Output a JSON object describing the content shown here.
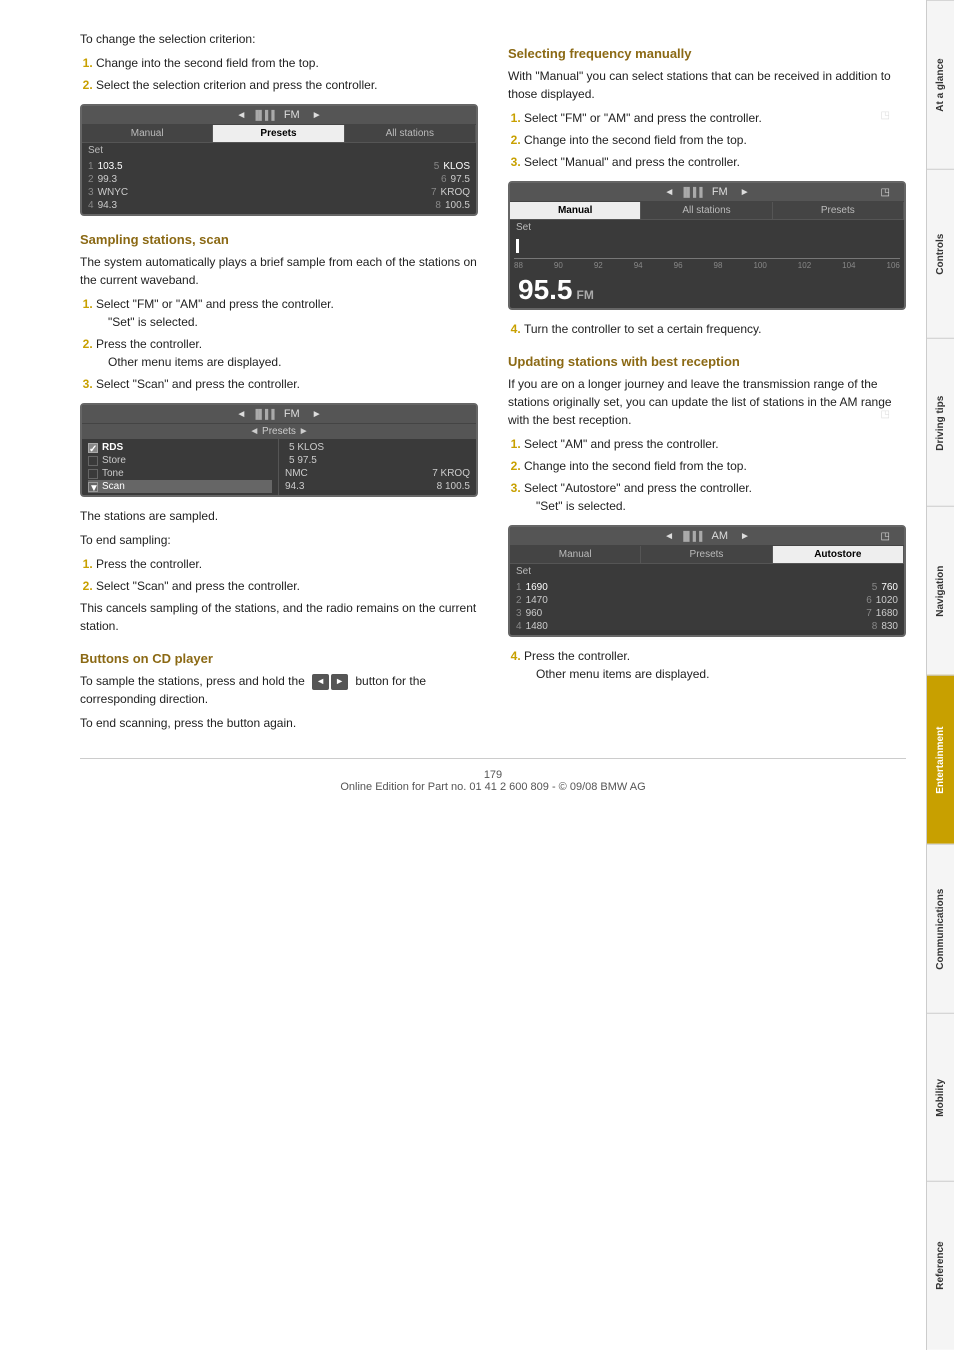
{
  "page": {
    "page_number": "179",
    "footer": "Online Edition for Part no. 01 41 2 600 809 - © 09/08 BMW AG"
  },
  "tabs": [
    {
      "id": "at-a-glance",
      "label": "At a glance",
      "active": false
    },
    {
      "id": "controls",
      "label": "Controls",
      "active": false
    },
    {
      "id": "driving-tips",
      "label": "Driving tips",
      "active": false
    },
    {
      "id": "navigation",
      "label": "Navigation",
      "active": false
    },
    {
      "id": "entertainment",
      "label": "Entertainment",
      "active": true
    },
    {
      "id": "communications",
      "label": "Communications",
      "active": false
    },
    {
      "id": "mobility",
      "label": "Mobility",
      "active": false
    },
    {
      "id": "reference",
      "label": "Reference",
      "active": false
    }
  ],
  "left": {
    "intro": "To change the selection criterion:",
    "steps_initial": [
      "Change into the second field from the top.",
      "Select the selection criterion and press the controller."
    ],
    "screen1": {
      "header": "FM",
      "tabs": [
        "Manual",
        "Presets",
        "All stations"
      ],
      "selected_tab": "Presets",
      "set_label": "Set",
      "stations": [
        {
          "num": "1",
          "name": "103.5",
          "num2": "5",
          "name2": "KLOS"
        },
        {
          "num": "2",
          "name": "99.3",
          "num2": "6",
          "name2": "97.5"
        },
        {
          "num": "",
          "name": "3 WNYC",
          "num2": "7",
          "name2": "KROQ"
        },
        {
          "num": "",
          "name": "4 94.3",
          "num2": "8",
          "name2": "100.5"
        }
      ]
    },
    "sampling_title": "Sampling stations, scan",
    "sampling_intro": "The system automatically plays a brief sample from each of the stations on the current waveband.",
    "sampling_steps": [
      {
        "text": "Select \"FM\" or \"AM\" and press the controller.",
        "sub": "\"Set\" is selected."
      },
      {
        "text": "Press the controller.",
        "sub": "Other menu items are displayed."
      },
      {
        "text": "Select \"Scan\" and press the controller."
      }
    ],
    "screen2": {
      "header": "FM",
      "presets_label": "◄ Presets ►",
      "menu_items": [
        {
          "label": "RDS",
          "checked": true
        },
        {
          "label": "Store",
          "checked": false
        },
        {
          "label": "Tone",
          "checked": false
        },
        {
          "label": "Scan",
          "checked": false,
          "active": true
        }
      ],
      "stations": [
        {
          "num": "5",
          "name": "KLOS"
        },
        {
          "num": "",
          "name": "5 97.5"
        },
        {
          "num": "NMC",
          "name": "7 KROQ"
        },
        {
          "num": "94.3",
          "name": "8 100.5"
        }
      ]
    },
    "sampled_note": "The stations are sampled.",
    "end_sampling": "To end sampling:",
    "end_steps": [
      "Press the controller.",
      "Select \"Scan\" and press the controller."
    ],
    "cancel_note": "This cancels sampling of the stations, and the radio remains on the current station.",
    "cd_title": "Buttons on CD player",
    "cd_text1": "To sample the stations, press and hold the",
    "cd_text2": "button for the corresponding direction.",
    "cd_text3": "To end scanning, press the button again."
  },
  "right": {
    "selecting_title": "Selecting frequency manually",
    "selecting_intro": "With \"Manual\" you can select stations that can be received in addition to those displayed.",
    "selecting_steps": [
      "Select \"FM\" or \"AM\" and press the controller.",
      "Change into the second field from the top.",
      "Select \"Manual\" and press the controller."
    ],
    "screen3": {
      "header": "FM",
      "tabs": [
        "Manual",
        "All stations",
        "Presets"
      ],
      "selected_tab": "Manual",
      "set_label": "Set",
      "cursor": true,
      "freq_scale": [
        "88",
        "90",
        "92",
        "94",
        "96",
        "98",
        "100",
        "102",
        "104",
        "106"
      ],
      "big_freq": "95.5",
      "freq_band": "FM"
    },
    "step4_text": "Turn the controller to set a certain frequency.",
    "updating_title": "Updating stations with best reception",
    "updating_intro": "If you are on a longer journey and leave the transmission range of the stations originally set, you can update the list of stations in the AM range with the best reception.",
    "updating_steps": [
      "Select \"AM\" and press the controller.",
      "Change into the second field from the top.",
      {
        "text": "Select \"Autostore\" and press the controller.",
        "sub": "\"Set\" is selected."
      }
    ],
    "screen4": {
      "header": "AM",
      "tabs": [
        "Manual",
        "Presets",
        "Autostore"
      ],
      "selected_tab": "Autostore",
      "set_label": "Set",
      "stations": [
        {
          "num": "1",
          "name": "1690",
          "num2": "5",
          "name2": "760"
        },
        {
          "num": "2",
          "name": "1470",
          "num2": "6",
          "name2": "1020"
        },
        {
          "num": "3",
          "name": "960",
          "num2": "7",
          "name2": "1680"
        },
        {
          "num": "4",
          "name": "1480",
          "num2": "8",
          "name2": "830"
        }
      ]
    },
    "step4b_text": "Press the controller.",
    "step4b_sub": "Other menu items are displayed."
  }
}
